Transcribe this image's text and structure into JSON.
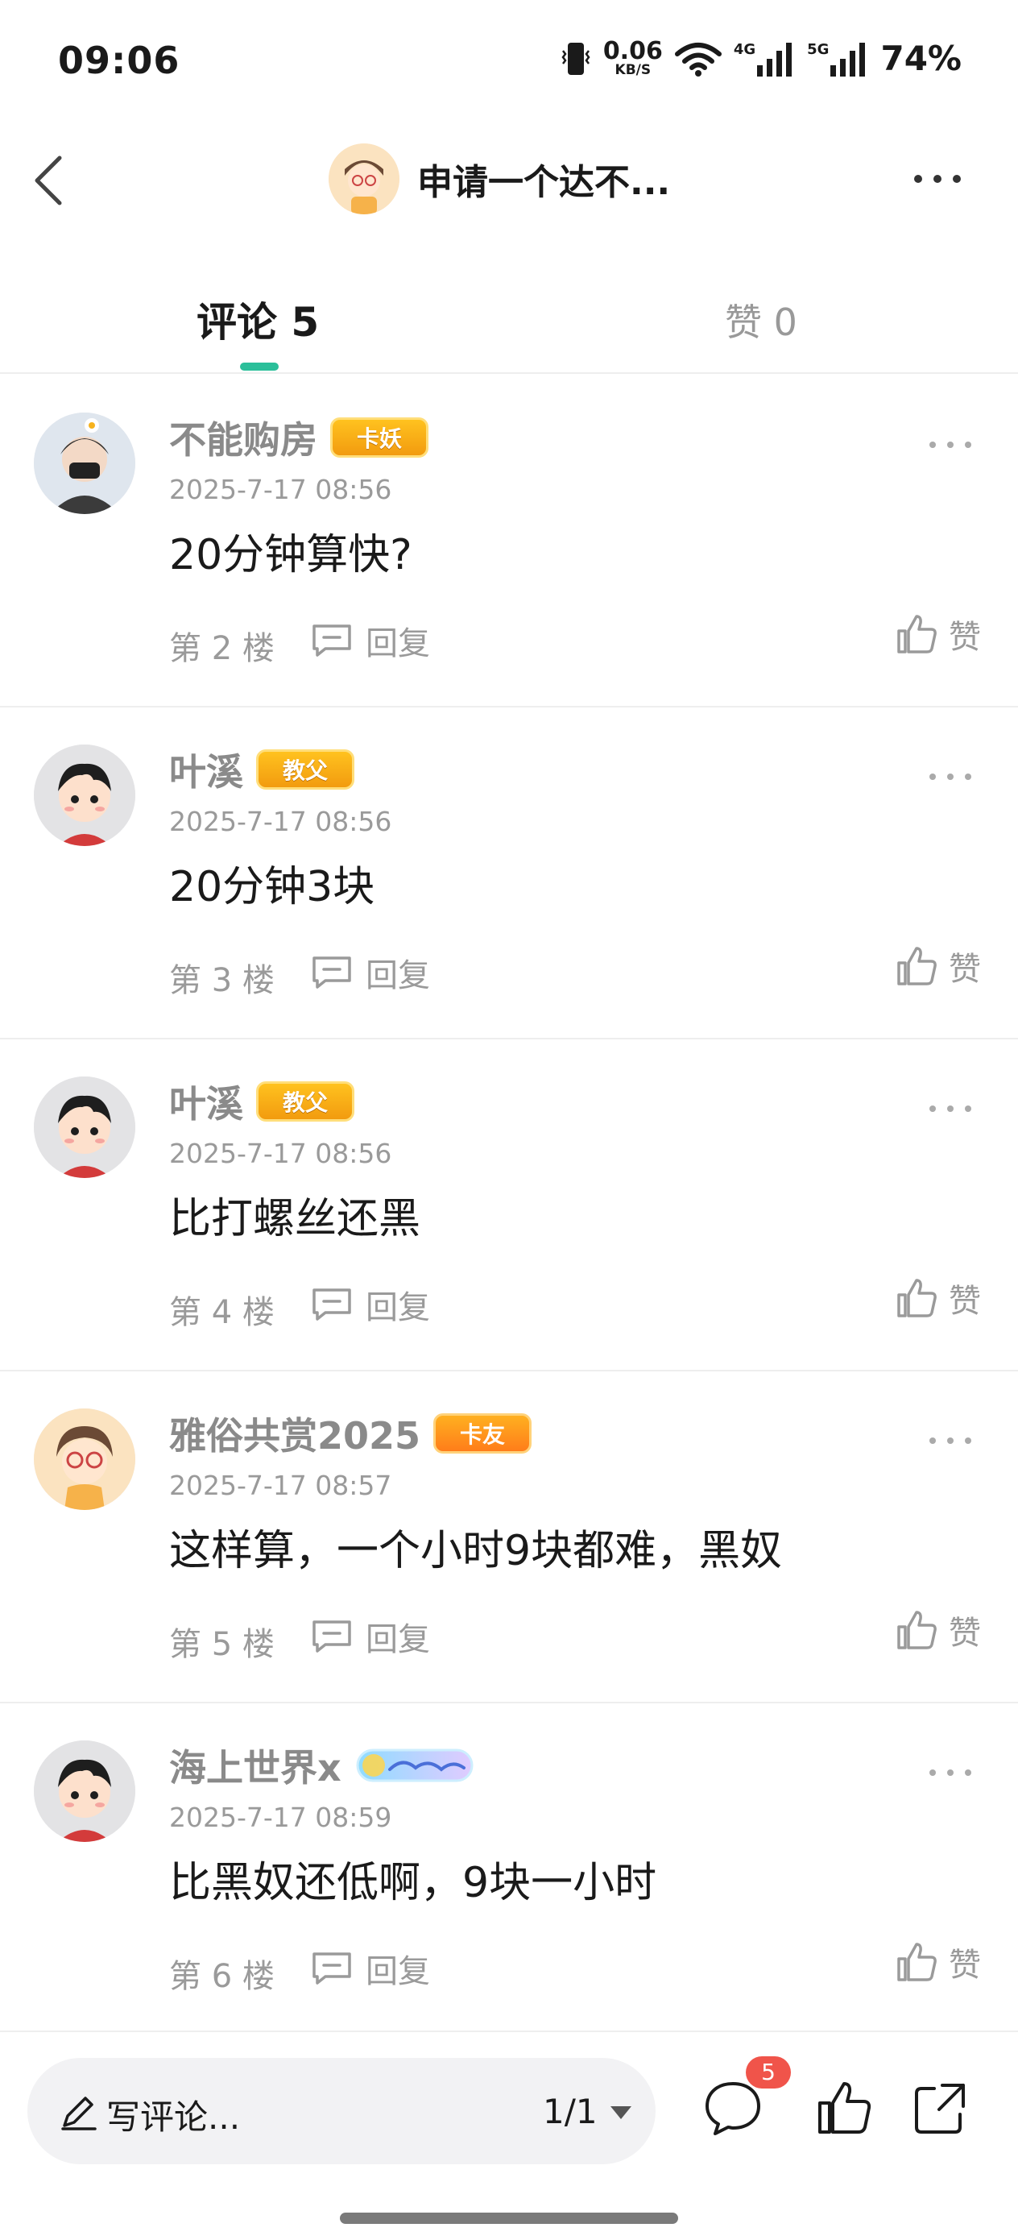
{
  "status_bar": {
    "time": "09:06",
    "net_speed_value": "0.06",
    "net_speed_unit": "KB/S",
    "signal_1": "4G",
    "signal_2": "5G",
    "battery": "74%",
    "icons": [
      "vibrate-icon",
      "wifi-icon",
      "signal-4g-icon",
      "signal-5g-icon"
    ]
  },
  "header": {
    "title": "申请一个达不...",
    "back_icon": "chevron-left-icon",
    "more_icon": "more-horizontal-icon"
  },
  "tabs": {
    "comments_label": "评论 5",
    "likes_label": "赞 0",
    "active": "comments",
    "accent_color": "#2bbf9a"
  },
  "comments": [
    {
      "name": "不能购房",
      "badge": "卡妖",
      "date": "2025-7-17 08:56",
      "text": "20分钟算快?",
      "floor": "第 2 楼",
      "reply_label": "回复",
      "like_label": "赞"
    },
    {
      "name": "叶溪",
      "badge": "教父",
      "date": "2025-7-17 08:56",
      "text": "20分钟3块",
      "floor": "第 3 楼",
      "reply_label": "回复",
      "like_label": "赞"
    },
    {
      "name": "叶溪",
      "badge": "教父",
      "date": "2025-7-17 08:56",
      "text": "比打螺丝还黑",
      "floor": "第 4 楼",
      "reply_label": "回复",
      "like_label": "赞"
    },
    {
      "name": "雅俗共赏2025",
      "badge": "卡友",
      "date": "2025-7-17 08:57",
      "text": "这样算，一个小时9块都难，黑奴",
      "floor": "第 5 楼",
      "reply_label": "回复",
      "like_label": "赞"
    },
    {
      "name": "海上世界x",
      "badge": "",
      "date": "2025-7-17 08:59",
      "text": "比黑奴还低啊，9块一小时",
      "floor": "第 6 楼",
      "reply_label": "回复",
      "like_label": "赞"
    }
  ],
  "bottom_bar": {
    "write_placeholder": "写评论...",
    "page_indicator": "1/1",
    "comment_count": "5",
    "icons": [
      "pencil-icon",
      "caret-down-icon",
      "comment-icon",
      "thumbs-up-icon",
      "share-icon"
    ]
  }
}
